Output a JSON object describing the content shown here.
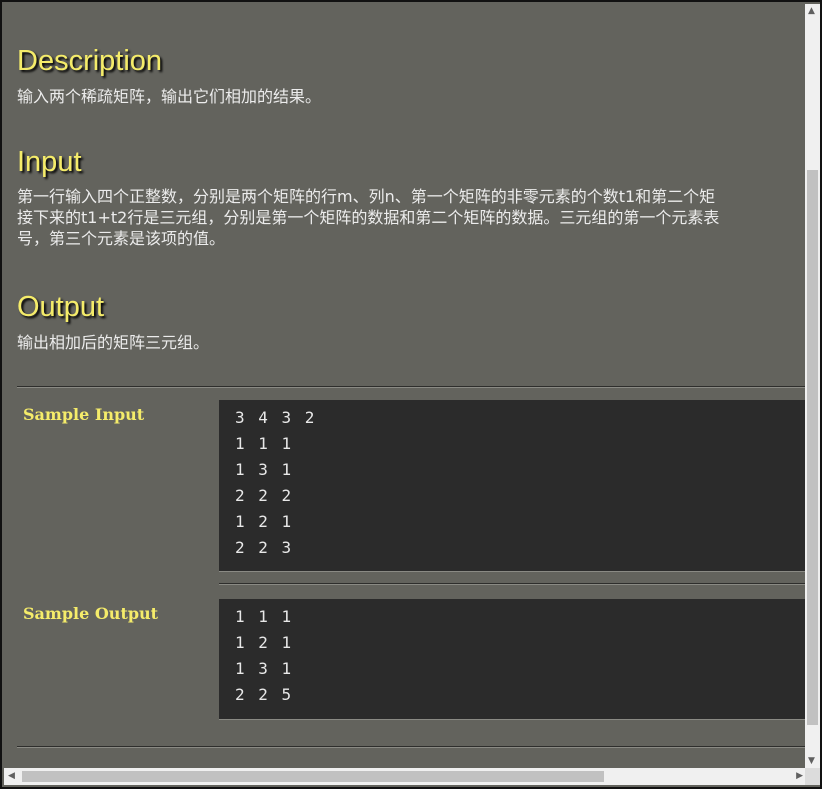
{
  "description": {
    "heading": "Description",
    "text": "输入两个稀疏矩阵，输出它们相加的结果。"
  },
  "input": {
    "heading": "Input",
    "lines": [
      "第一行输入四个正整数，分别是两个矩阵的行m、列n、第一个矩阵的非零元素的个数t1和第二个矩",
      "接下来的t1+t2行是三元组，分别是第一个矩阵的数据和第二个矩阵的数据。三元组的第一个元素表",
      "号，第三个元素是该项的值。"
    ]
  },
  "output": {
    "heading": "Output",
    "text": "输出相加后的矩阵三元组。"
  },
  "sample_input": {
    "label": "Sample Input",
    "lines": [
      "3 4 3 2",
      "1 1 1",
      "1 3 1",
      "2 2 2",
      "1 2 1",
      "2 2 3"
    ]
  },
  "sample_output": {
    "label": "Sample Output",
    "lines": [
      "1 1 1",
      "1 2 1",
      "1 3 1",
      "2 2 5"
    ]
  },
  "scrollbars": {
    "up_icon": "▲",
    "down_icon": "▼",
    "left_icon": "◀",
    "right_icon": "▶"
  }
}
